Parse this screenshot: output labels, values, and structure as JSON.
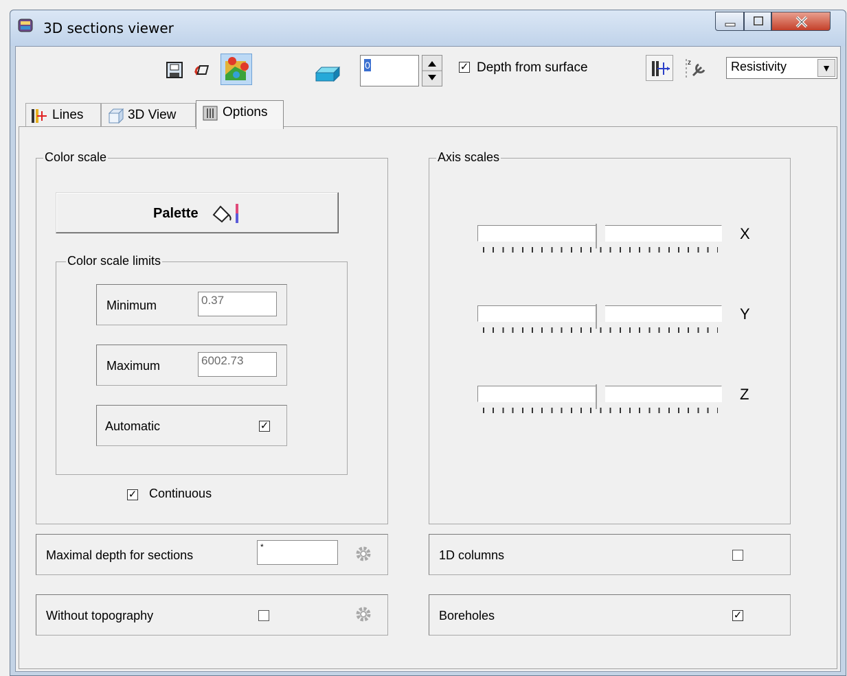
{
  "window": {
    "title": "3D sections viewer",
    "buttons": {
      "minimize": "minimize-icon",
      "maximize": "maximize-icon",
      "close": "close-icon"
    }
  },
  "toolbar": {
    "icons": [
      "save-image-icon",
      "rotate-icon",
      "palette-points-icon",
      "layer-icon",
      "grid-lines-icon",
      "settings-scale-icon"
    ],
    "layer_value": "0",
    "depth_from_surface": {
      "label": "Depth from surface",
      "checked": true
    },
    "parameter_select": {
      "value": "Resistivity"
    }
  },
  "tabs": [
    {
      "label": "Lines",
      "icon": "lines-icon",
      "active": false
    },
    {
      "label": "3D View",
      "icon": "cube-icon",
      "active": false
    },
    {
      "label": "Options",
      "icon": "options-icon",
      "active": true
    }
  ],
  "color_scale": {
    "group_label": "Color scale",
    "palette_label": "Palette",
    "limits": {
      "group_label": "Color scale limits",
      "minimum_label": "Minimum",
      "minimum_value": "0.37",
      "maximum_label": "Maximum",
      "maximum_value": "6002.73",
      "automatic_label": "Automatic",
      "automatic_checked": true
    },
    "continuous_label": "Continuous",
    "continuous_checked": true
  },
  "axis_scales": {
    "group_label": "Axis scales",
    "sliders": [
      {
        "axis": "X",
        "level": 0.5
      },
      {
        "axis": "Y",
        "level": 0.5
      },
      {
        "axis": "Z",
        "level": 0.5
      }
    ]
  },
  "options": {
    "maximal_depth_label": "Maximal depth for sections",
    "maximal_depth_value": "*",
    "without_topography_label": "Without topography",
    "without_topography_checked": false,
    "columns_1d_label": "1D columns",
    "columns_1d_checked": false,
    "boreholes_label": "Boreholes",
    "boreholes_checked": true
  },
  "colors": {
    "accent": "#3a6fd0",
    "close": "#c4402a"
  }
}
